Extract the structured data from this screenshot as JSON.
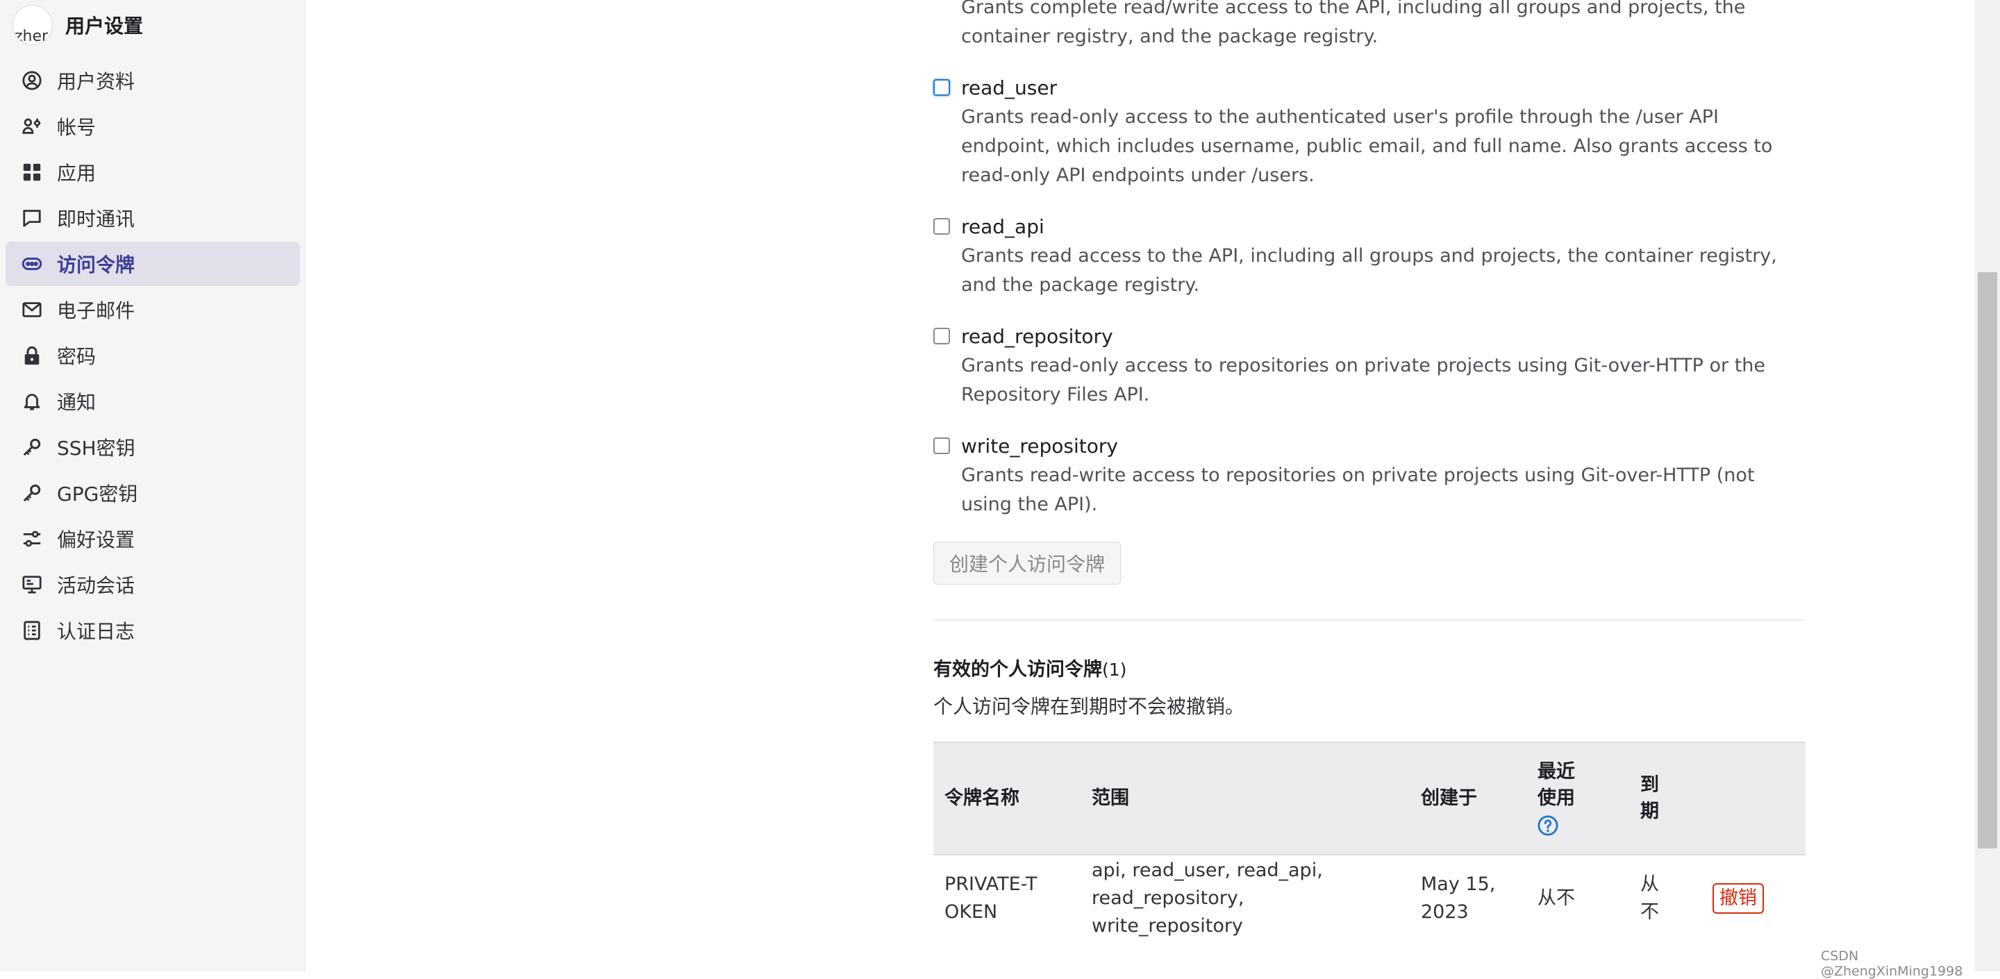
{
  "sidebar": {
    "avatar_text": "zher",
    "title": "用户设置",
    "items": [
      {
        "label": "用户资料",
        "icon": "user-circle-icon"
      },
      {
        "label": "帐号",
        "icon": "account-icon"
      },
      {
        "label": "应用",
        "icon": "applications-icon"
      },
      {
        "label": "即时通讯",
        "icon": "chat-icon"
      },
      {
        "label": "访问令牌",
        "icon": "token-icon",
        "active": true
      },
      {
        "label": "电子邮件",
        "icon": "mail-icon"
      },
      {
        "label": "密码",
        "icon": "lock-icon"
      },
      {
        "label": "通知",
        "icon": "bell-icon"
      },
      {
        "label": "SSH密钥",
        "icon": "key-icon"
      },
      {
        "label": "GPG密钥",
        "icon": "key-icon"
      },
      {
        "label": "偏好设置",
        "icon": "preferences-icon"
      },
      {
        "label": "活动会话",
        "icon": "monitor-icon"
      },
      {
        "label": "认证日志",
        "icon": "log-icon"
      }
    ]
  },
  "main": {
    "api_scope_description": "Grants complete read/write access to the API, including all groups and projects, the container registry, and the package registry.",
    "scopes": [
      {
        "name": "read_user",
        "description": "Grants read-only access to the authenticated user's profile through the /user API endpoint, which includes username, public email, and full name. Also grants access to read-only API endpoints under /users."
      },
      {
        "name": "read_api",
        "description": "Grants read access to the API, including all groups and projects, the container registry, and the package registry."
      },
      {
        "name": "read_repository",
        "description": "Grants read-only access to repositories on private projects using Git-over-HTTP or the Repository Files API."
      },
      {
        "name": "write_repository",
        "description": "Grants read-write access to repositories on private projects using Git-over-HTTP (not using the API)."
      }
    ],
    "create_button": "创建个人访问令牌",
    "active_tokens_title": "有效的个人访问令牌",
    "active_tokens_count": "(1)",
    "active_tokens_note": "个人访问令牌在到期时不会被撤销。",
    "table": {
      "headers": {
        "name": "令牌名称",
        "scopes": "范围",
        "created": "创建于",
        "last_used": "最近使用",
        "expires": "到期"
      },
      "rows": [
        {
          "name": "PRIVATE-TOKEN",
          "scopes": "api, read_user, read_api, read_repository, write_repository",
          "created": "May 15, 2023",
          "last_used": "从不",
          "expires": "从不",
          "action": "撤销"
        }
      ]
    }
  },
  "watermark": "CSDN @ZhengXinMing1998",
  "colors": {
    "accent": "#3d3f97",
    "danger": "#dd2b0e",
    "sidebar_bg": "#f5f5f6",
    "active_bg": "#e1e0ea"
  }
}
